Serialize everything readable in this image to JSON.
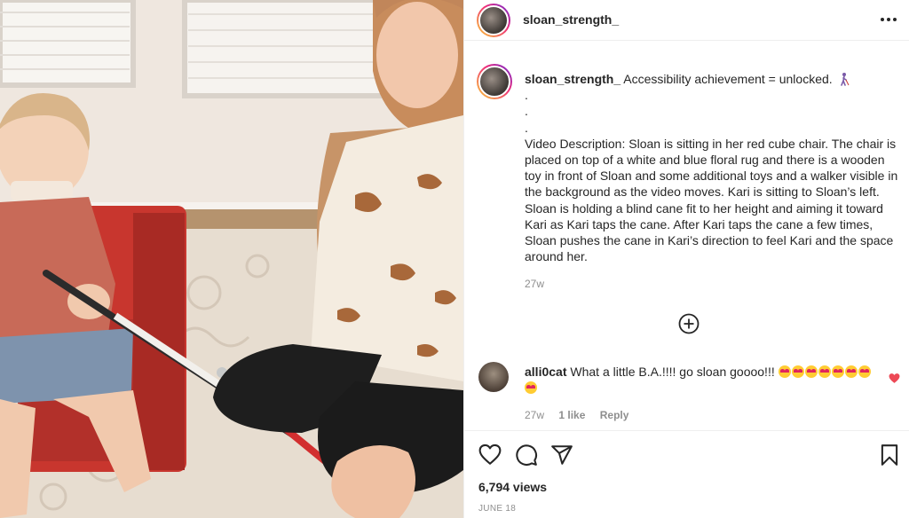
{
  "post": {
    "username": "sloan_strength_",
    "caption_username": "sloan_strength_",
    "caption_headline": "Accessibility achievement = unlocked.",
    "caption_dots": [
      ".",
      ".",
      "."
    ],
    "caption_description": "Video Description: Sloan is sitting in her red cube chair. The chair is placed on top of a white and blue floral rug and there is a wooden toy in front of Sloan and some additional toys and a walker visible in the background as the video moves. Kari is sitting to Sloan’s left. Sloan is holding a blind cane fit to her height and aiming it toward Kari as Kari taps the cane. After Kari taps the cane a few times, Sloan pushes the cane in Kari’s direction to feel Kari and the space around her.",
    "caption_time": "27w",
    "views": "6,794 views",
    "date": "JUNE 18"
  },
  "comment": {
    "username": "alli0cat",
    "text": "What a little B.A.!!!! go sloan goooo!!!",
    "emoji_count": 8,
    "time": "27w",
    "likes": "1 like",
    "reply_label": "Reply"
  },
  "icons": {
    "more": "more-horizontal-icon",
    "load_more": "plus-circle-icon",
    "like": "heart-icon",
    "comment": "comment-icon",
    "share": "send-icon",
    "save": "bookmark-icon"
  },
  "colors": {
    "liked_heart": "#ed4956",
    "muted_text": "#8e8e8e",
    "chair_red": "#c8362e"
  }
}
